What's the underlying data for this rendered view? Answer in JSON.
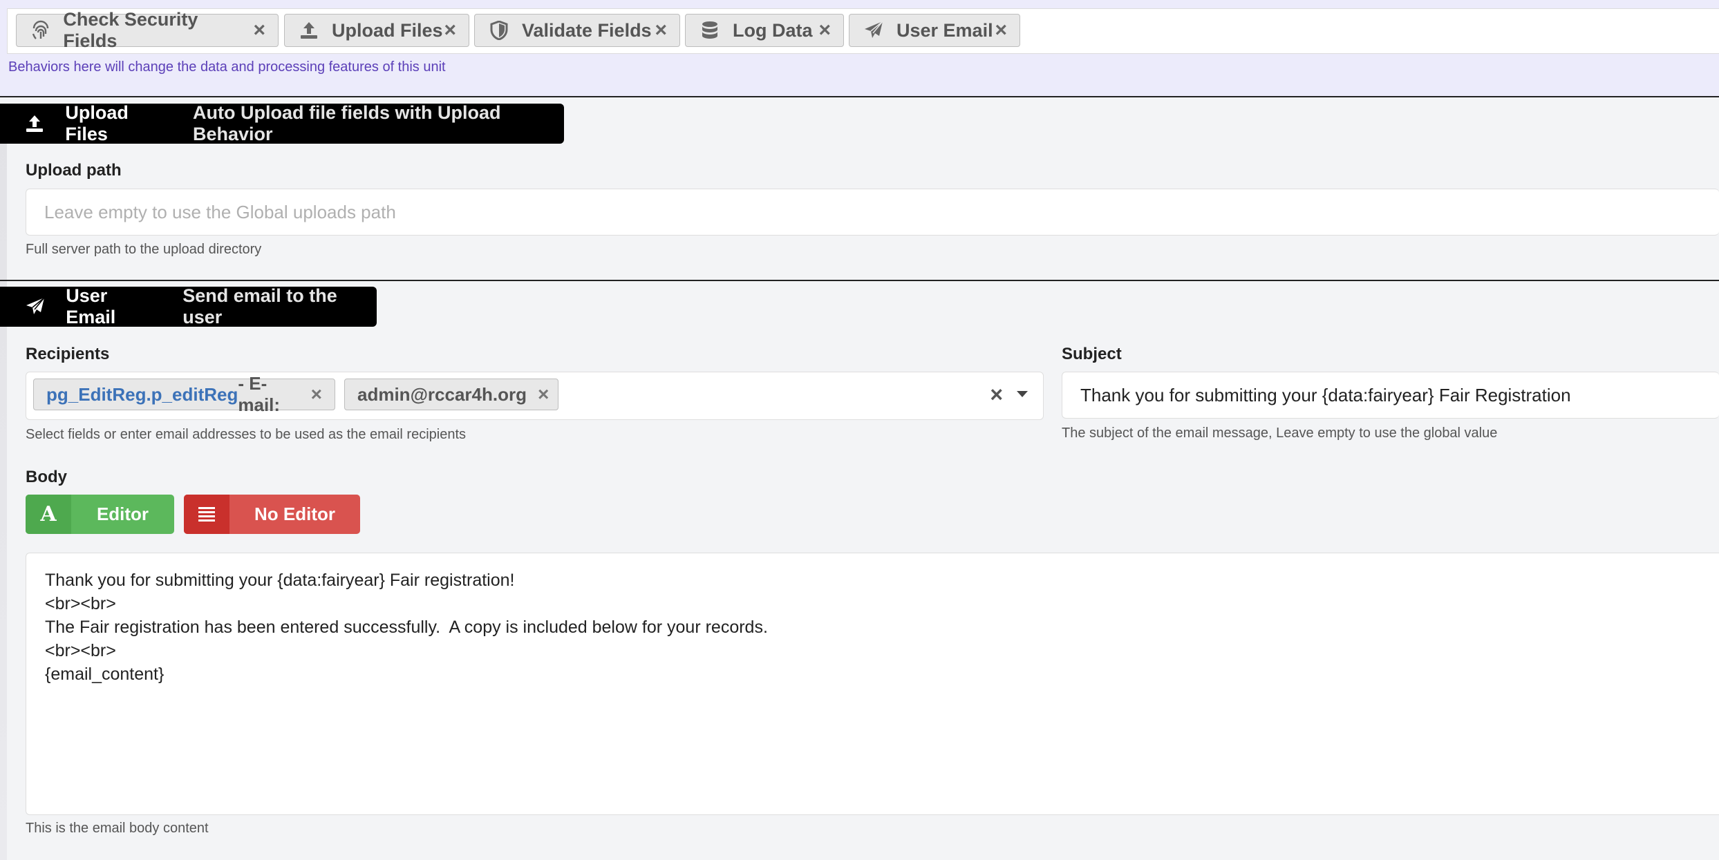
{
  "behaviors": {
    "tags": [
      {
        "label": "Check Security Fields",
        "icon": "fingerprint-icon"
      },
      {
        "label": "Upload Files",
        "icon": "upload-icon"
      },
      {
        "label": "Validate Fields",
        "icon": "shield-icon"
      },
      {
        "label": "Log Data",
        "icon": "database-icon"
      },
      {
        "label": "User Email",
        "icon": "paper-plane-icon"
      }
    ],
    "remove_glyph": "×",
    "note": "Behaviors here will change the data and processing features of this unit"
  },
  "upload_section": {
    "title": "Upload Files",
    "description": "Auto Upload file fields with Upload Behavior",
    "path_label": "Upload path",
    "path_value": "",
    "path_placeholder": "Leave empty to use the Global uploads path",
    "path_help": "Full server path to the upload directory"
  },
  "email_section": {
    "title": "User Email",
    "description": "Send email to the user",
    "recipients_label": "Recipients",
    "recipients": [
      {
        "field": "pg_EditReg.p_editReg",
        "suffix": " - E-mail:"
      },
      {
        "field": "",
        "suffix": "admin@rccar4h.org"
      }
    ],
    "clear_glyph": "×",
    "recipients_help": "Select fields or enter email addresses to be used as the email recipients",
    "subject_label": "Subject",
    "subject_value": "Thank you for submitting your {data:fairyear} Fair Registration",
    "subject_help": "The subject of the email message, Leave empty to use the global value",
    "body_label": "Body",
    "editor_button": {
      "icon_text": "A",
      "label": "Editor"
    },
    "no_editor_button": {
      "label": "No Editor"
    },
    "body_lines": [
      "Thank you for submitting your {data:fairyear} Fair registration!",
      "<br><br>",
      "The Fair registration has been entered successfully.  A copy is included below for your records.",
      "<br><br>",
      "{email_content}"
    ],
    "body_help": "This is the email body content"
  },
  "colors": {
    "accent_purple": "#5b3fb8",
    "editor_green": "#5cb85c",
    "no_editor_red": "#d9534f",
    "link_blue": "#3c72b8"
  }
}
